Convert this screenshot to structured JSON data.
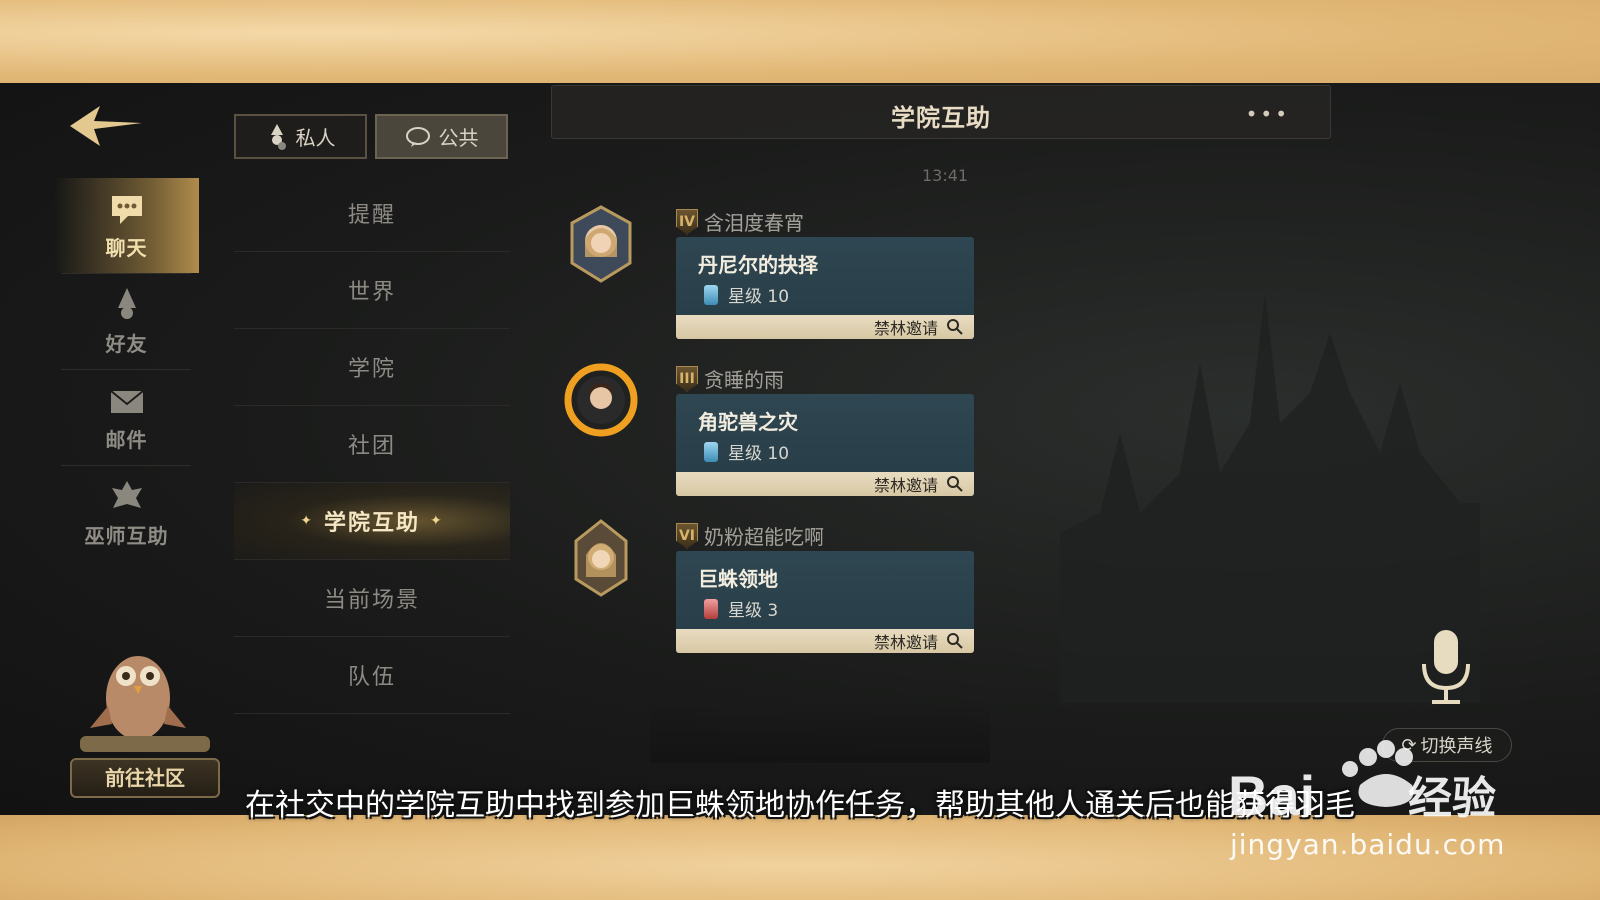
{
  "colors": {
    "accent_gold": "#e2c489",
    "card_teal": "#2f4752",
    "invite_bar": "#e3d6b9"
  },
  "nav": {
    "back_icon": "back-arrow-icon",
    "items": [
      {
        "label": "聊天",
        "icon": "chat-bubble-icon",
        "active": true
      },
      {
        "label": "好友",
        "icon": "wizard-hat-icon",
        "active": false
      },
      {
        "label": "邮件",
        "icon": "envelope-icon",
        "active": false
      },
      {
        "label": "巫师互助",
        "icon": "wizard-crest-icon",
        "active": false
      }
    ],
    "community": {
      "label": "前往社区",
      "icon": "owl-icon"
    }
  },
  "tabs": [
    {
      "label": "私人",
      "icon": "wizard-person-icon",
      "active": false
    },
    {
      "label": "公共",
      "icon": "speech-icon",
      "active": true
    }
  ],
  "channels": [
    "提醒",
    "世界",
    "学院",
    "社团",
    "学院互助",
    "当前场景",
    "队伍"
  ],
  "active_channel": "学院互助",
  "chat": {
    "title": "学院互助",
    "more_label": "•••",
    "timestamp": "13:41",
    "messages": [
      {
        "rank": "IV",
        "sender": "含泪度春宵",
        "quest": "丹尼尔的抉择",
        "star_label": "星级 10",
        "lantern": "blue",
        "invite": "禁林邀请"
      },
      {
        "rank": "III",
        "sender": "贪睡的雨",
        "quest": "角驼兽之灾",
        "star_label": "星级 10",
        "lantern": "blue",
        "invite": "禁林邀请"
      },
      {
        "rank": "VI",
        "sender": "奶粉超能吃啊",
        "quest": "巨蛛领地",
        "star_label": "星级 3",
        "lantern": "red",
        "invite": "禁林邀请"
      }
    ]
  },
  "voice": {
    "mic_icon": "microphone-icon",
    "switch_label": "切换声线"
  },
  "caption": "在社交中的学院互助中找到参加巨蛛领地协作任务，帮助其他人通关后也能获得羽毛",
  "watermark": {
    "brand": "Bai",
    "brand_cn": "经验",
    "url": "jingyan.baidu.com"
  }
}
